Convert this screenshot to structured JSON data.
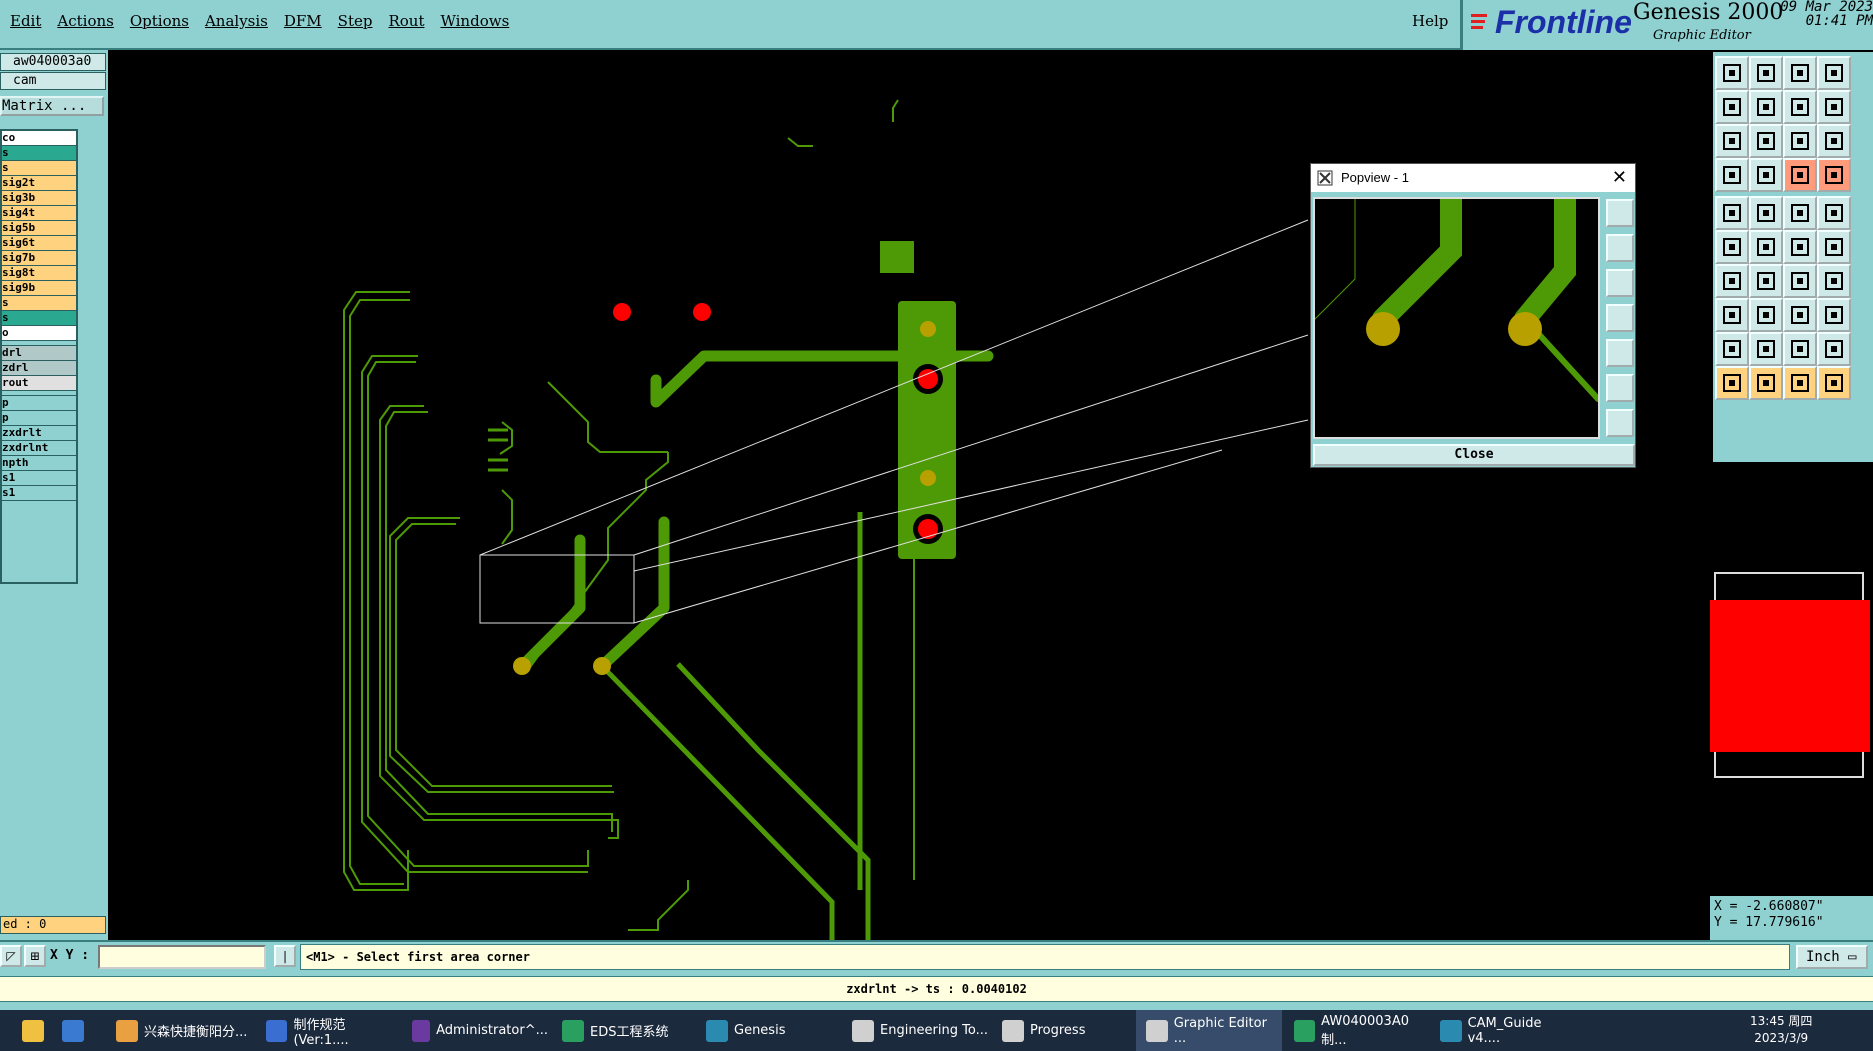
{
  "menu": {
    "items": [
      "Edit",
      "Actions",
      "Options",
      "Analysis",
      "DFM",
      "Step",
      "Rout",
      "Windows"
    ],
    "help": "Help"
  },
  "brand": {
    "logo": "Frontline",
    "product": "Genesis 2000",
    "subtitle": "Graphic Editor",
    "date": "09 Mar 2023",
    "time": "01:41 PM"
  },
  "job": {
    "name": "aw040003a0",
    "step": "cam",
    "matrix_label": "Matrix ..."
  },
  "layers": [
    {
      "name": "co",
      "color": "#ffffff"
    },
    {
      "name": "s",
      "color": "#2aa890"
    },
    {
      "name": "s",
      "color": "#ffd27f"
    },
    {
      "name": "sig2t",
      "color": "#ffd27f"
    },
    {
      "name": "sig3b",
      "color": "#ffd27f"
    },
    {
      "name": "sig4t",
      "color": "#ffd27f"
    },
    {
      "name": "sig5b",
      "color": "#ffd27f"
    },
    {
      "name": "sig6t",
      "color": "#ffd27f"
    },
    {
      "name": "sig7b",
      "color": "#ffd27f"
    },
    {
      "name": "sig8t",
      "color": "#ffd27f"
    },
    {
      "name": "sig9b",
      "color": "#ffd27f"
    },
    {
      "name": "s",
      "color": "#ffd27f"
    },
    {
      "name": "s",
      "color": "#2aa890"
    },
    {
      "name": "o",
      "color": "#ffffff"
    },
    {
      "gap": true
    },
    {
      "name": "drl",
      "color": "#b0c8c8"
    },
    {
      "name": "zdrl",
      "color": "#b0c8c8"
    },
    {
      "name": "rout",
      "color": "#e0e0e0"
    },
    {
      "gap": true
    },
    {
      "name": "p",
      "color": "#8fd0d0"
    },
    {
      "name": "p",
      "color": "#8fd0d0"
    },
    {
      "name": "zxdrlt",
      "color": "#8fd0d0"
    },
    {
      "name": "zxdrlnt",
      "color": "#8fd0d0"
    },
    {
      "name": "npth",
      "color": "#8fd0d0"
    },
    {
      "name": "s1",
      "color": "#8fd0d0"
    },
    {
      "name": "s1",
      "color": "#8fd0d0"
    }
  ],
  "counter": "ed : 0",
  "popview": {
    "title": "Popview - 1",
    "close_label": "Close"
  },
  "coords": {
    "x": "X = -2.660807\"",
    "y": "Y = 17.779616\""
  },
  "cmd": {
    "xy_label": "X Y :",
    "input_value": "",
    "prompt": "<M1> - Select first area corner",
    "units": "Inch"
  },
  "status": {
    "measure": "zxdrlnt -> ts : 0.0040102"
  },
  "taskbar": {
    "items": [
      {
        "label": "兴森快捷衡阳分...",
        "color": "#e8a040"
      },
      {
        "label": "制作规范 (Ver:1....",
        "color": "#3a6ed0"
      },
      {
        "label": "Administrator^...",
        "color": "#6a3aa0"
      },
      {
        "label": "EDS工程系统",
        "color": "#2aa060"
      },
      {
        "label": "Genesis",
        "color": "#2a8ab0"
      },
      {
        "label": "Engineering To...",
        "color": "#d0d0d0"
      },
      {
        "label": "Progress",
        "color": "#d0d0d0"
      },
      {
        "label": "Graphic Editor ...",
        "color": "#d0d0d0"
      },
      {
        "label": "AW040003A0制...",
        "color": "#2aa060"
      },
      {
        "label": "CAM_Guide v4....",
        "color": "#2a8ab0"
      }
    ],
    "clock_time": "13:45 周四",
    "clock_date": "2023/3/9"
  },
  "colors": {
    "panel": "#8fd0d0",
    "trace": "#4e9a06",
    "pad": "#b8a000",
    "drill": "#ff0000"
  }
}
